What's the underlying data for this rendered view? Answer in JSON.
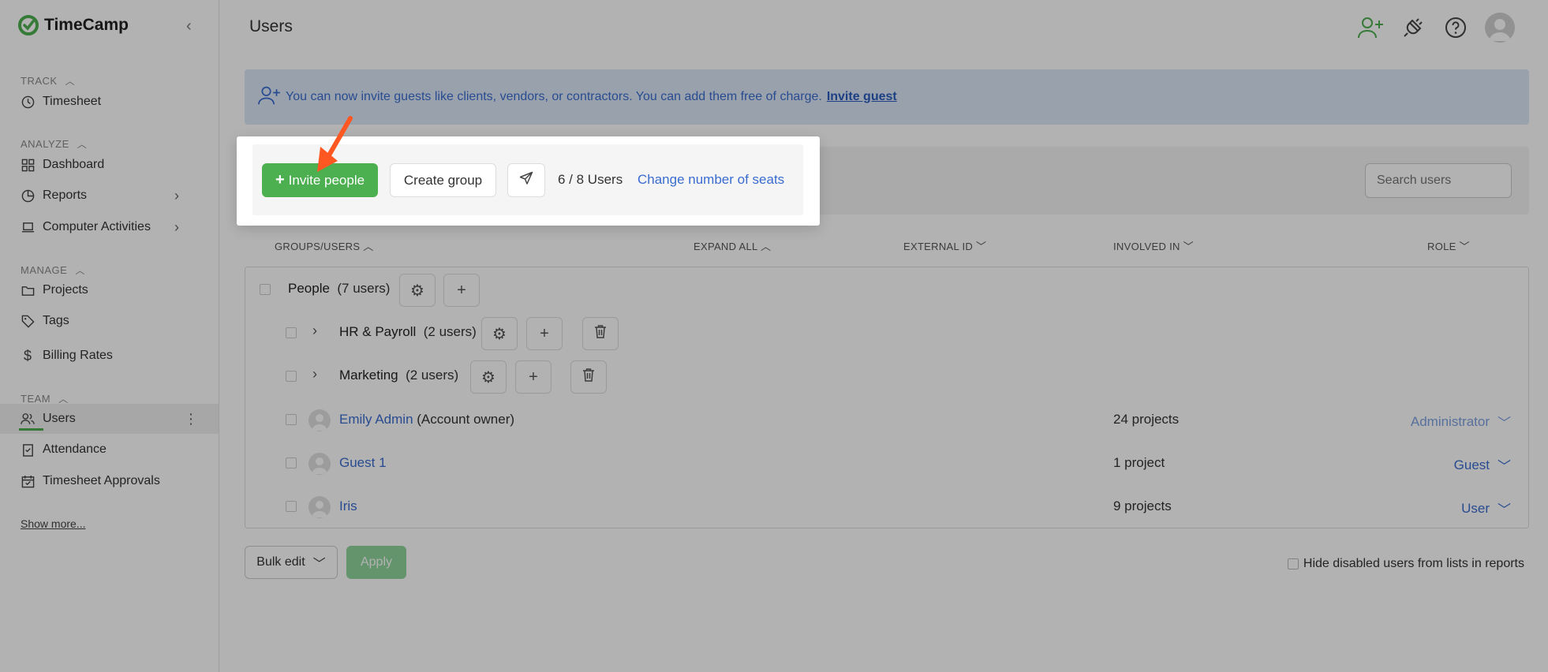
{
  "app": {
    "name": "TimeCamp"
  },
  "sidebar": {
    "sections": [
      {
        "label": "TRACK"
      },
      {
        "label": "ANALYZE"
      },
      {
        "label": "MANAGE"
      },
      {
        "label": "TEAM"
      }
    ],
    "items": [
      {
        "label": "Timesheet",
        "icon": "clock-icon"
      },
      {
        "label": "Dashboard",
        "icon": "dashboard-icon"
      },
      {
        "label": "Reports",
        "icon": "reports-icon"
      },
      {
        "label": "Computer Activities",
        "icon": "laptop-icon"
      },
      {
        "label": "Projects",
        "icon": "folder-icon"
      },
      {
        "label": "Tags",
        "icon": "tag-icon"
      },
      {
        "label": "Billing Rates",
        "icon": "dollar-icon"
      },
      {
        "label": "Users",
        "icon": "users-icon"
      },
      {
        "label": "Attendance",
        "icon": "attendance-icon"
      },
      {
        "label": "Timesheet Approvals",
        "icon": "calendar-check-icon"
      }
    ],
    "show_more": "Show more..."
  },
  "header": {
    "title": "Users"
  },
  "banner": {
    "text": "You can now invite guests like clients, vendors, or contractors. You can add them free of charge.",
    "link": "Invite guest"
  },
  "toolbar": {
    "invite_label": "Invite people",
    "create_group_label": "Create group",
    "seat_count": "6 / 8 Users",
    "change_seats_label": "Change number of seats",
    "search_placeholder": "Search users"
  },
  "table": {
    "headers": {
      "groups_users": "GROUPS/USERS",
      "expand_all": "EXPAND ALL",
      "external_id": "EXTERNAL ID",
      "involved_in": "INVOLVED IN",
      "role": "ROLE"
    },
    "root_group": {
      "name": "People",
      "count": "(7 users)"
    },
    "subgroups": [
      {
        "name": "HR & Payroll",
        "count": "(2 users)"
      },
      {
        "name": "Marketing",
        "count": "(2 users)"
      }
    ],
    "users": [
      {
        "name": "Emily Admin",
        "note": "(Account owner)",
        "projects": "24 projects",
        "role": "Administrator"
      },
      {
        "name": "Guest 1",
        "note": "",
        "projects": "1 project",
        "role": "Guest"
      },
      {
        "name": "Iris",
        "note": "",
        "projects": "9 projects",
        "role": "User"
      }
    ]
  },
  "footer": {
    "bulk_edit_label": "Bulk edit",
    "apply_label": "Apply",
    "hide_disabled_label": "Hide disabled users from lists in reports"
  },
  "colors": {
    "accent": "#4caf50",
    "link": "#3a6cd0",
    "arrow": "#ff5722"
  }
}
